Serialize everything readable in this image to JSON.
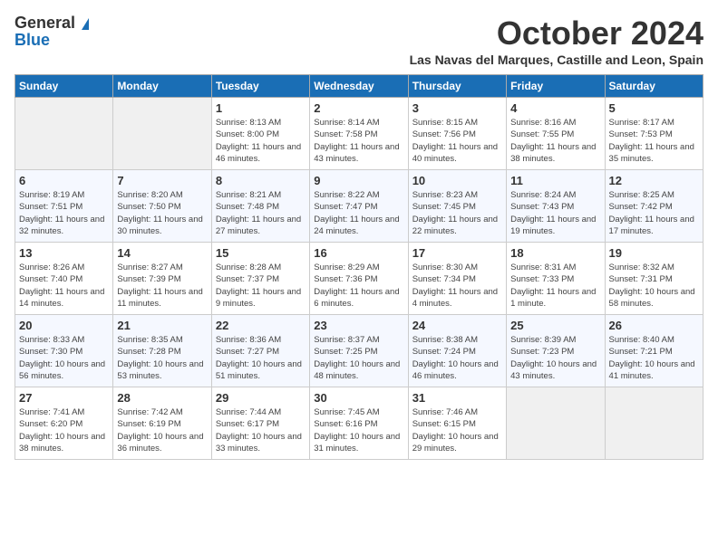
{
  "header": {
    "logo_general": "General",
    "logo_blue": "Blue",
    "title": "October 2024",
    "location": "Las Navas del Marques, Castille and Leon, Spain"
  },
  "days_of_week": [
    "Sunday",
    "Monday",
    "Tuesday",
    "Wednesday",
    "Thursday",
    "Friday",
    "Saturday"
  ],
  "weeks": [
    [
      {
        "day": "",
        "content": ""
      },
      {
        "day": "",
        "content": ""
      },
      {
        "day": "1",
        "content": "Sunrise: 8:13 AM\nSunset: 8:00 PM\nDaylight: 11 hours and 46 minutes."
      },
      {
        "day": "2",
        "content": "Sunrise: 8:14 AM\nSunset: 7:58 PM\nDaylight: 11 hours and 43 minutes."
      },
      {
        "day": "3",
        "content": "Sunrise: 8:15 AM\nSunset: 7:56 PM\nDaylight: 11 hours and 40 minutes."
      },
      {
        "day": "4",
        "content": "Sunrise: 8:16 AM\nSunset: 7:55 PM\nDaylight: 11 hours and 38 minutes."
      },
      {
        "day": "5",
        "content": "Sunrise: 8:17 AM\nSunset: 7:53 PM\nDaylight: 11 hours and 35 minutes."
      }
    ],
    [
      {
        "day": "6",
        "content": "Sunrise: 8:19 AM\nSunset: 7:51 PM\nDaylight: 11 hours and 32 minutes."
      },
      {
        "day": "7",
        "content": "Sunrise: 8:20 AM\nSunset: 7:50 PM\nDaylight: 11 hours and 30 minutes."
      },
      {
        "day": "8",
        "content": "Sunrise: 8:21 AM\nSunset: 7:48 PM\nDaylight: 11 hours and 27 minutes."
      },
      {
        "day": "9",
        "content": "Sunrise: 8:22 AM\nSunset: 7:47 PM\nDaylight: 11 hours and 24 minutes."
      },
      {
        "day": "10",
        "content": "Sunrise: 8:23 AM\nSunset: 7:45 PM\nDaylight: 11 hours and 22 minutes."
      },
      {
        "day": "11",
        "content": "Sunrise: 8:24 AM\nSunset: 7:43 PM\nDaylight: 11 hours and 19 minutes."
      },
      {
        "day": "12",
        "content": "Sunrise: 8:25 AM\nSunset: 7:42 PM\nDaylight: 11 hours and 17 minutes."
      }
    ],
    [
      {
        "day": "13",
        "content": "Sunrise: 8:26 AM\nSunset: 7:40 PM\nDaylight: 11 hours and 14 minutes."
      },
      {
        "day": "14",
        "content": "Sunrise: 8:27 AM\nSunset: 7:39 PM\nDaylight: 11 hours and 11 minutes."
      },
      {
        "day": "15",
        "content": "Sunrise: 8:28 AM\nSunset: 7:37 PM\nDaylight: 11 hours and 9 minutes."
      },
      {
        "day": "16",
        "content": "Sunrise: 8:29 AM\nSunset: 7:36 PM\nDaylight: 11 hours and 6 minutes."
      },
      {
        "day": "17",
        "content": "Sunrise: 8:30 AM\nSunset: 7:34 PM\nDaylight: 11 hours and 4 minutes."
      },
      {
        "day": "18",
        "content": "Sunrise: 8:31 AM\nSunset: 7:33 PM\nDaylight: 11 hours and 1 minute."
      },
      {
        "day": "19",
        "content": "Sunrise: 8:32 AM\nSunset: 7:31 PM\nDaylight: 10 hours and 58 minutes."
      }
    ],
    [
      {
        "day": "20",
        "content": "Sunrise: 8:33 AM\nSunset: 7:30 PM\nDaylight: 10 hours and 56 minutes."
      },
      {
        "day": "21",
        "content": "Sunrise: 8:35 AM\nSunset: 7:28 PM\nDaylight: 10 hours and 53 minutes."
      },
      {
        "day": "22",
        "content": "Sunrise: 8:36 AM\nSunset: 7:27 PM\nDaylight: 10 hours and 51 minutes."
      },
      {
        "day": "23",
        "content": "Sunrise: 8:37 AM\nSunset: 7:25 PM\nDaylight: 10 hours and 48 minutes."
      },
      {
        "day": "24",
        "content": "Sunrise: 8:38 AM\nSunset: 7:24 PM\nDaylight: 10 hours and 46 minutes."
      },
      {
        "day": "25",
        "content": "Sunrise: 8:39 AM\nSunset: 7:23 PM\nDaylight: 10 hours and 43 minutes."
      },
      {
        "day": "26",
        "content": "Sunrise: 8:40 AM\nSunset: 7:21 PM\nDaylight: 10 hours and 41 minutes."
      }
    ],
    [
      {
        "day": "27",
        "content": "Sunrise: 7:41 AM\nSunset: 6:20 PM\nDaylight: 10 hours and 38 minutes."
      },
      {
        "day": "28",
        "content": "Sunrise: 7:42 AM\nSunset: 6:19 PM\nDaylight: 10 hours and 36 minutes."
      },
      {
        "day": "29",
        "content": "Sunrise: 7:44 AM\nSunset: 6:17 PM\nDaylight: 10 hours and 33 minutes."
      },
      {
        "day": "30",
        "content": "Sunrise: 7:45 AM\nSunset: 6:16 PM\nDaylight: 10 hours and 31 minutes."
      },
      {
        "day": "31",
        "content": "Sunrise: 7:46 AM\nSunset: 6:15 PM\nDaylight: 10 hours and 29 minutes."
      },
      {
        "day": "",
        "content": ""
      },
      {
        "day": "",
        "content": ""
      }
    ]
  ]
}
